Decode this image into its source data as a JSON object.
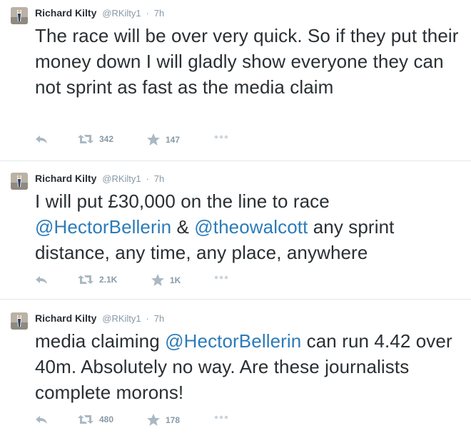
{
  "tweets": [
    {
      "name": "Richard Kilty",
      "handle": "@RKilty1",
      "separator": "·",
      "time": "7h",
      "text_plain": "The race will be over very quick. So if they put their money down I will gladly show everyone they can not sprint as fast as the media claim",
      "retweets": "342",
      "favorites": "147"
    },
    {
      "name": "Richard Kilty",
      "handle": "@RKilty1",
      "separator": "·",
      "time": "7h",
      "text_part1": "I will put £30,000 on the line to race ",
      "mention1": "@HectorBellerin",
      "text_part2": " & ",
      "mention2": "@theowalcott",
      "text_part3": " any sprint distance, any time, any place, anywhere",
      "retweets": "2.1K",
      "favorites": "1K"
    },
    {
      "name": "Richard Kilty",
      "handle": "@RKilty1",
      "separator": "·",
      "time": "7h",
      "text_part1": "media claiming ",
      "mention1": "@HectorBellerin",
      "text_part2": " can run 4.42 over 40m. Absolutely no way. Are these journalists complete morons!",
      "retweets": "480",
      "favorites": "178"
    }
  ],
  "colors": {
    "text": "#292f33",
    "muted": "#8899a6",
    "link": "#2b7bb9",
    "divider": "#e1e8ed"
  },
  "icons": {
    "reply": "reply-icon",
    "retweet": "retweet-icon",
    "favorite": "star-icon",
    "more": "more-dots-icon"
  }
}
